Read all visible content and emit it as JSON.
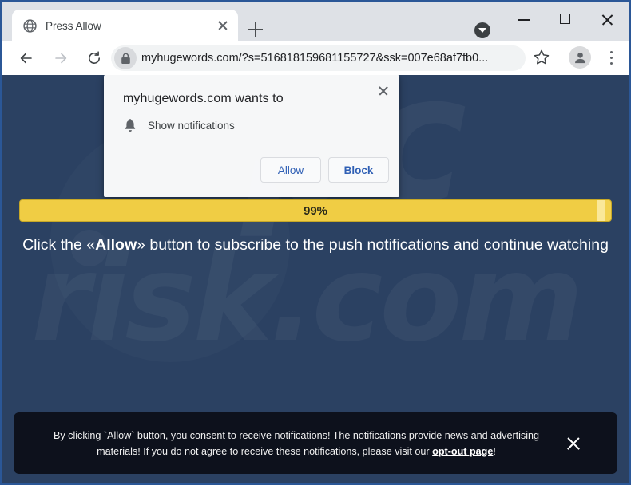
{
  "browser": {
    "tab": {
      "title": "Press Allow",
      "favicon": "globe-icon",
      "close_label": "Close tab"
    },
    "new_tab_label": "New tab",
    "tab_search_label": "Search tabs",
    "window_controls": {
      "minimize": "Minimize",
      "maximize": "Maximize",
      "close": "Close"
    },
    "toolbar": {
      "back_label": "Back",
      "forward_label": "Forward",
      "reload_label": "Reload",
      "url": "myhugewords.com/?s=516818159681155727&ssk=007e68af7fb0...",
      "lock_icon": "lock-icon",
      "bookmark_label": "Bookmark this tab",
      "profile_label": "Profile",
      "menu_label": "Customize and control Google Chrome"
    }
  },
  "permission_bubble": {
    "title": "myhugewords.com wants to",
    "permission_icon": "bell-icon",
    "permission_label": "Show notifications",
    "allow_label": "Allow",
    "block_label": "Block",
    "close_label": "Close"
  },
  "page": {
    "background_color": "#2b4162",
    "watermark_text": "risk.com",
    "watermark_top_text": "pc",
    "progress": {
      "percent_label": "99%",
      "percent_value": 99,
      "bar_color": "#f0cd44",
      "border_color": "#c7a827"
    },
    "instruction": {
      "before": "Click the «",
      "emphasis": "Allow",
      "after": "» button to subscribe to the push notifications and continue watching"
    }
  },
  "consent_banner": {
    "text_before_link": "By clicking `Allow` button, you consent to receive notifications! The notifications provide news and advertising materials! If you do not agree to receive these notifications, please visit our ",
    "link_text": "opt-out page",
    "text_after_link": "!",
    "close_label": "Close",
    "background_color": "#0d111c"
  }
}
